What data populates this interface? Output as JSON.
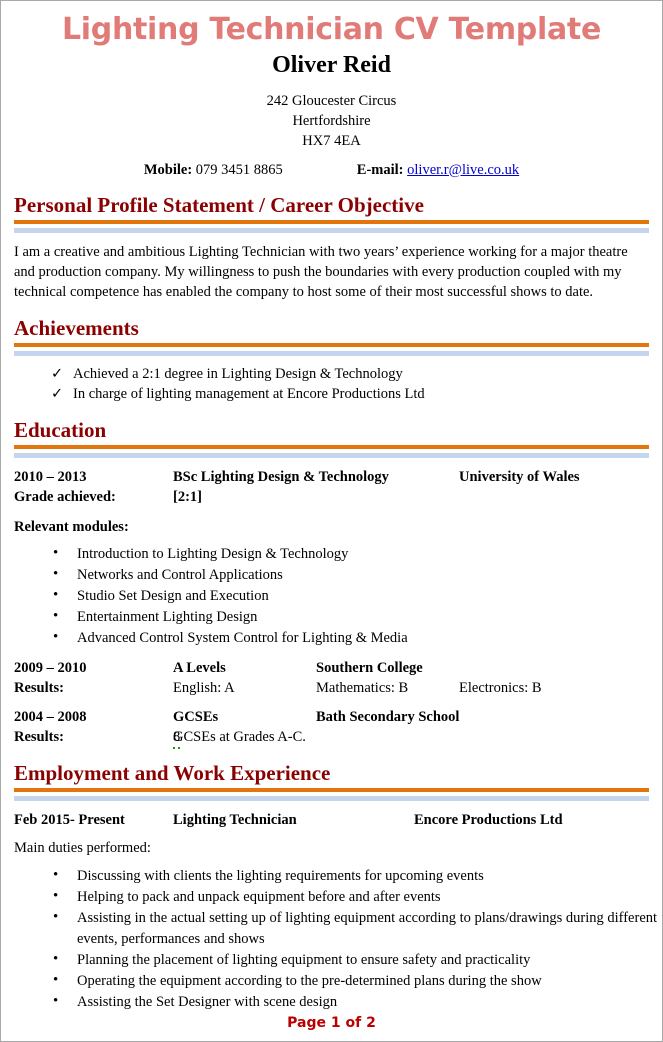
{
  "document": {
    "title": "Lighting Technician CV Template",
    "name": "Oliver Reid"
  },
  "contact": {
    "address_lines": [
      "242 Gloucester Circus",
      "Hertfordshire",
      "HX7 4EA"
    ],
    "mobile_label": "Mobile:",
    "mobile_value": "079 3451 8865",
    "email_label": "E-mail:",
    "email_value": "oliver.r@live.co.uk"
  },
  "sections": {
    "profile": {
      "heading": "Personal Profile Statement / Career Objective",
      "text": "I am a creative and ambitious Lighting Technician with two years’ experience working for a major theatre and production company.  My willingness to push the boundaries with every production coupled with my technical competence has enabled the company to host some of their most successful shows to date."
    },
    "achievements": {
      "heading": "Achievements",
      "items": [
        "Achieved a 2:1 degree in Lighting Design & Technology",
        "In charge of lighting management at Encore Productions Ltd"
      ]
    },
    "education": {
      "heading": "Education",
      "degree": {
        "dates": "2010 – 2013",
        "qualification": "BSc Lighting Design & Technology",
        "institution": "University of Wales",
        "grade_label": "Grade achieved:",
        "grade_value": "[2:1]"
      },
      "modules_label": "Relevant modules:",
      "modules": [
        "Introduction to Lighting Design & Technology",
        "Networks and Control Applications",
        "Studio Set Design and Execution",
        "Entertainment Lighting Design",
        "Advanced Control System Control for Lighting & Media"
      ],
      "a_levels": {
        "dates": "2009 – 2010",
        "qualification": "A Levels",
        "institution": "Southern College",
        "results_label": "Results:",
        "result_1": "English: A",
        "result_2": "Mathematics: B",
        "result_3": "Electronics: B"
      },
      "gcses": {
        "dates": "2004 – 2008",
        "qualification": "GCSEs",
        "institution": "Bath Secondary School",
        "results_label": "Results:",
        "results_count": "8",
        "results_text": " GCSEs at Grades A-C."
      }
    },
    "employment": {
      "heading": "Employment and Work Experience",
      "job": {
        "dates": "Feb 2015- Present",
        "role": "Lighting Technician",
        "company": "Encore Productions Ltd"
      },
      "duties_label": "Main duties performed:",
      "duties": [
        "Discussing with clients the lighting requirements for upcoming events",
        "Helping to pack and unpack equipment before and after events",
        "Assisting in the actual setting up of lighting equipment according to plans/drawings during different events, performances and shows",
        "Planning the placement of lighting equipment to ensure safety and practicality",
        "Operating the equipment according to the pre-determined plans during the show",
        "Assisting the Set Designer with scene design"
      ]
    }
  },
  "footer": {
    "page_label": "Page 1 of 2"
  },
  "colors": {
    "title": "#e07b78",
    "heading": "#8b0000",
    "rule_orange": "#e2760c",
    "rule_blue": "#c6d5ee",
    "link": "#0000d0",
    "footer": "#bb0000"
  }
}
